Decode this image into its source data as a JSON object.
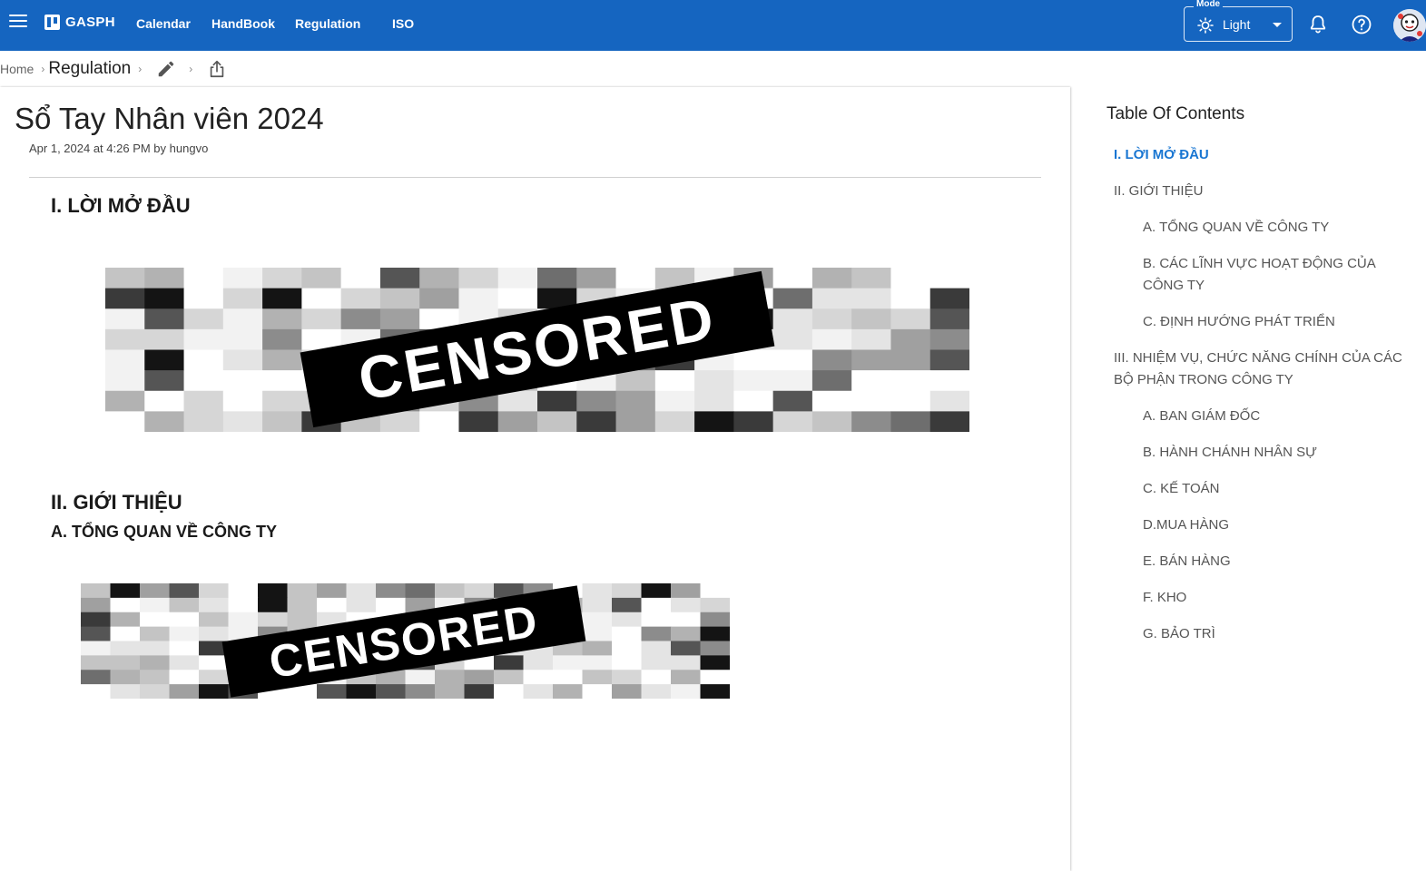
{
  "appbar": {
    "brand": "GASPH",
    "nav": [
      "Calendar",
      "HandBook",
      "Regulation",
      "ISO"
    ],
    "mode_label": "Mode",
    "mode_value": "Light",
    "color": "#1565c0"
  },
  "breadcrumb": {
    "home": "Home",
    "current": "Regulation"
  },
  "document": {
    "title": "Sổ Tay Nhân viên 2024",
    "meta": "Apr 1, 2024 at 4:26 PM by hungvo",
    "sections": {
      "s1": "I. LỜI MỞ ĐẦU",
      "s2": "II. GIỚI THIỆU",
      "s2a": "A. TỔNG QUAN VỀ CÔNG TY"
    },
    "censored_text": "CENSORED"
  },
  "toc": {
    "heading": "Table Of Contents",
    "items": [
      {
        "label": "I. LỜI MỞ ĐẦU",
        "active": true
      },
      {
        "label": "II. GIỚI THIỆU"
      },
      {
        "label": "A. TỔNG QUAN VỀ CÔNG TY"
      },
      {
        "label": "B. CÁC LĨNH VỰC HOẠT ĐỘNG CỦA CÔNG TY"
      },
      {
        "label": "C. ĐỊNH HƯỚNG PHÁT TRIỂN"
      },
      {
        "label": "III. NHIỆM VỤ, CHỨC NĂNG CHÍNH CỦA CÁC BỘ PHẬN TRONG CÔNG TY"
      },
      {
        "label": "A. BAN GIÁM ĐỐC"
      },
      {
        "label": "B. HÀNH CHÁNH NHÂN SỰ"
      },
      {
        "label": "C. KẾ TOÁN"
      },
      {
        "label": "D.MUA HÀNG"
      },
      {
        "label": "E. BÁN HÀNG"
      },
      {
        "label": "F. KHO"
      },
      {
        "label": "G. BẢO TRÌ"
      }
    ],
    "active_color": "#1976d2"
  }
}
